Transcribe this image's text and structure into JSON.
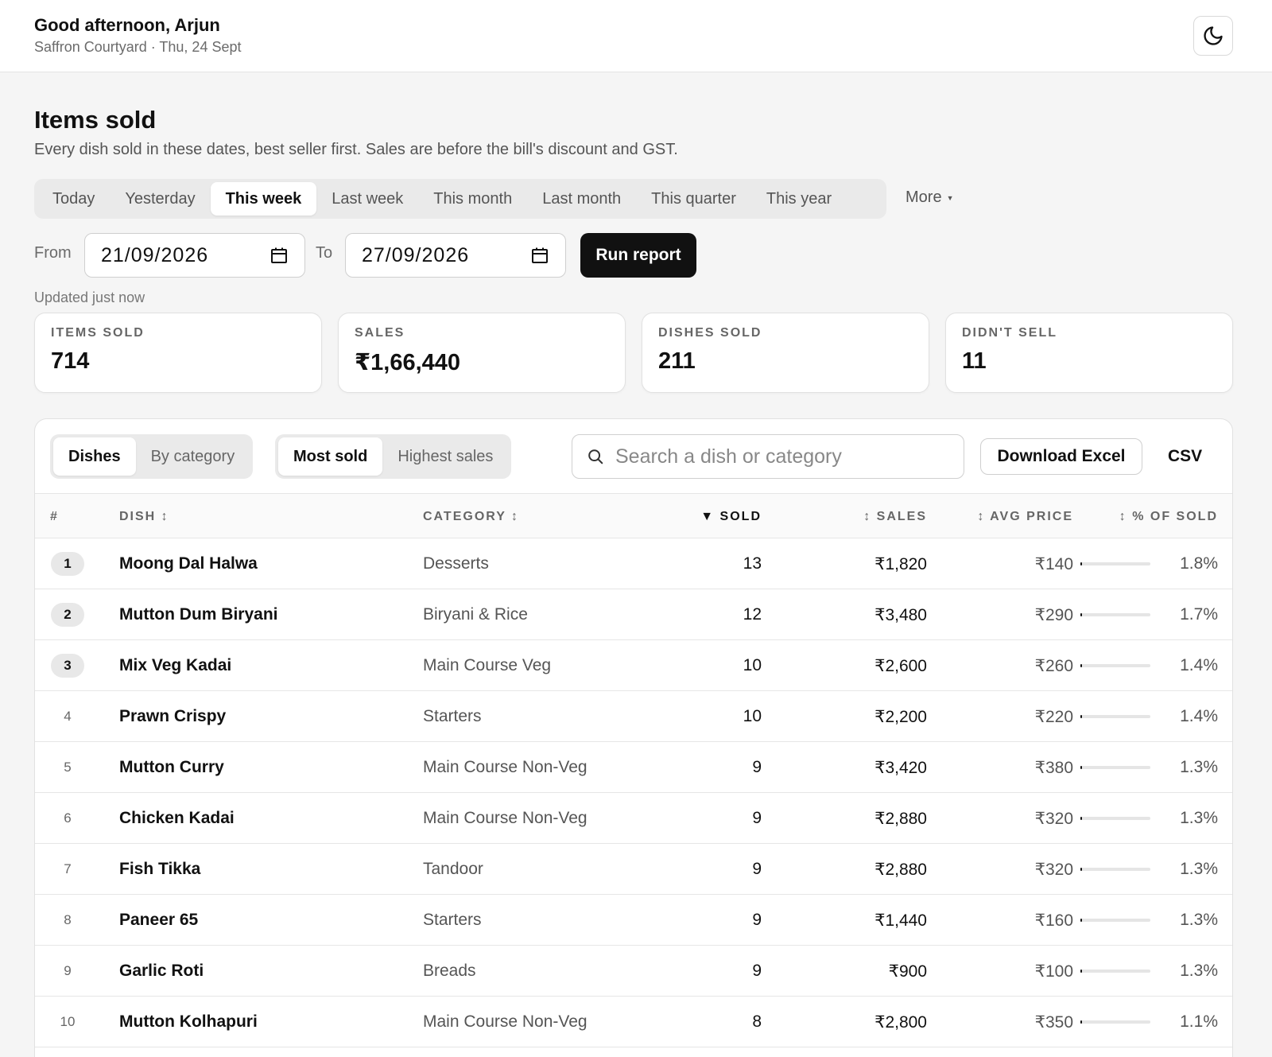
{
  "header": {
    "greeting": "Good afternoon, Arjun",
    "subtitle": "Saffron Courtyard · Thu, 24 Sept",
    "theme_icon": "moon-icon"
  },
  "page": {
    "title": "Items sold",
    "description": "Every dish sold in these dates, best seller first. Sales are before the bill's discount and GST."
  },
  "range_tabs": [
    {
      "label": "Today",
      "active": false
    },
    {
      "label": "Yesterday",
      "active": false
    },
    {
      "label": "This week",
      "active": true
    },
    {
      "label": "Last week",
      "active": false
    },
    {
      "label": "This month",
      "active": false
    },
    {
      "label": "Last month",
      "active": false
    },
    {
      "label": "This quarter",
      "active": false
    },
    {
      "label": "This year",
      "active": false
    }
  ],
  "more_label": "More",
  "filters": {
    "from_label": "From",
    "from_value": "21/09/2026",
    "to_label": "To",
    "to_value": "27/09/2026",
    "run_label": "Run report"
  },
  "updated": "Updated just now",
  "stats": [
    {
      "label": "ITEMS SOLD",
      "value": "714"
    },
    {
      "label": "SALES",
      "value": "₹1,66,440"
    },
    {
      "label": "DISHES SOLD",
      "value": "211"
    },
    {
      "label": "DIDN'T SELL",
      "value": "11"
    }
  ],
  "toolbar": {
    "view_toggle": [
      {
        "label": "Dishes",
        "active": true
      },
      {
        "label": "By category",
        "active": false
      }
    ],
    "sort_toggle": [
      {
        "label": "Most sold",
        "active": true
      },
      {
        "label": "Highest sales",
        "active": false
      }
    ],
    "search_placeholder": "Search a dish or category",
    "download_excel": "Download Excel",
    "csv": "CSV"
  },
  "table": {
    "columns": {
      "rank": "#",
      "dish": "DISH ↕",
      "category": "CATEGORY ↕",
      "sold": "▼ SOLD",
      "sales": "↕ SALES",
      "avg_price": "↕ AVG PRICE",
      "pct_sold": "↕ % OF SOLD"
    },
    "rows": [
      {
        "rank": "1",
        "dish": "Moong Dal Halwa",
        "category": "Desserts",
        "sold": "13",
        "sales": "₹1,820",
        "avg": "₹140",
        "pct": "1.8%",
        "share": 0.018,
        "highlight": true
      },
      {
        "rank": "2",
        "dish": "Mutton Dum Biryani",
        "category": "Biryani & Rice",
        "sold": "12",
        "sales": "₹3,480",
        "avg": "₹290",
        "pct": "1.7%",
        "share": 0.017,
        "highlight": true
      },
      {
        "rank": "3",
        "dish": "Mix Veg Kadai",
        "category": "Main Course Veg",
        "sold": "10",
        "sales": "₹2,600",
        "avg": "₹260",
        "pct": "1.4%",
        "share": 0.014,
        "highlight": true
      },
      {
        "rank": "4",
        "dish": "Prawn Crispy",
        "category": "Starters",
        "sold": "10",
        "sales": "₹2,200",
        "avg": "₹220",
        "pct": "1.4%",
        "share": 0.014,
        "highlight": false
      },
      {
        "rank": "5",
        "dish": "Mutton Curry",
        "category": "Main Course Non-Veg",
        "sold": "9",
        "sales": "₹3,420",
        "avg": "₹380",
        "pct": "1.3%",
        "share": 0.013,
        "highlight": false
      },
      {
        "rank": "6",
        "dish": "Chicken Kadai",
        "category": "Main Course Non-Veg",
        "sold": "9",
        "sales": "₹2,880",
        "avg": "₹320",
        "pct": "1.3%",
        "share": 0.013,
        "highlight": false
      },
      {
        "rank": "7",
        "dish": "Fish Tikka",
        "category": "Tandoor",
        "sold": "9",
        "sales": "₹2,880",
        "avg": "₹320",
        "pct": "1.3%",
        "share": 0.013,
        "highlight": false
      },
      {
        "rank": "8",
        "dish": "Paneer 65",
        "category": "Starters",
        "sold": "9",
        "sales": "₹1,440",
        "avg": "₹160",
        "pct": "1.3%",
        "share": 0.013,
        "highlight": false
      },
      {
        "rank": "9",
        "dish": "Garlic Roti",
        "category": "Breads",
        "sold": "9",
        "sales": "₹900",
        "avg": "₹100",
        "pct": "1.3%",
        "share": 0.013,
        "highlight": false
      },
      {
        "rank": "10",
        "dish": "Mutton Kolhapuri",
        "category": "Main Course Non-Veg",
        "sold": "8",
        "sales": "₹2,800",
        "avg": "₹350",
        "pct": "1.1%",
        "share": 0.011,
        "highlight": false
      }
    ]
  }
}
